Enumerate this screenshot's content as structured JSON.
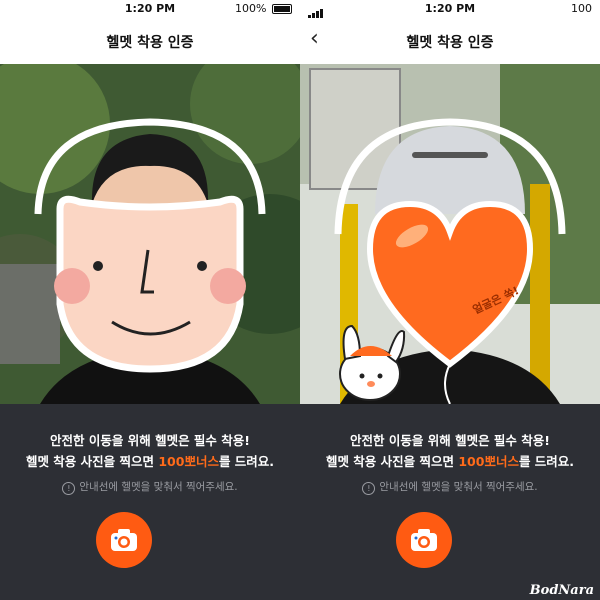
{
  "screens": [
    {
      "status": {
        "time": "1:20 PM",
        "battery": "100%"
      },
      "nav": {
        "title": "헬멧 착용 인증",
        "back": ""
      },
      "sticker_text": "",
      "message": {
        "line1": "안전한 이동을 위해 헬멧은 필수 착용!",
        "line2_prefix": "헬멧 착용 사진을 찍으면 ",
        "line2_highlight": "100뽀너스",
        "line2_suffix": "를 드려요."
      },
      "hint": "안내선에 헬멧을 맞춰서 찍어주세요.",
      "icons": {
        "camera": "camera-icon",
        "info": "info-icon"
      }
    },
    {
      "status": {
        "time": "1:20 PM",
        "battery": "100"
      },
      "nav": {
        "title": "헬멧 착용 인증",
        "back": "‹"
      },
      "sticker_text": "얼굴은 쏙!",
      "message": {
        "line1": "안전한 이동을 위해 헬멧은 필수 착용!",
        "line2_prefix": "헬멧 착용 사진을 찍으면 ",
        "line2_highlight": "100뽀너스",
        "line2_suffix": "를 드려요."
      },
      "hint": "안내선에 헬멧을 맞춰서 찍어주세요.",
      "icons": {
        "camera": "camera-icon",
        "info": "info-icon",
        "back": "back-chevron-icon"
      }
    }
  ],
  "brand_logo": "BodNara",
  "colors": {
    "accent": "#ff5b12",
    "highlight": "#ff6b1a",
    "panel": "#2d2f35"
  }
}
